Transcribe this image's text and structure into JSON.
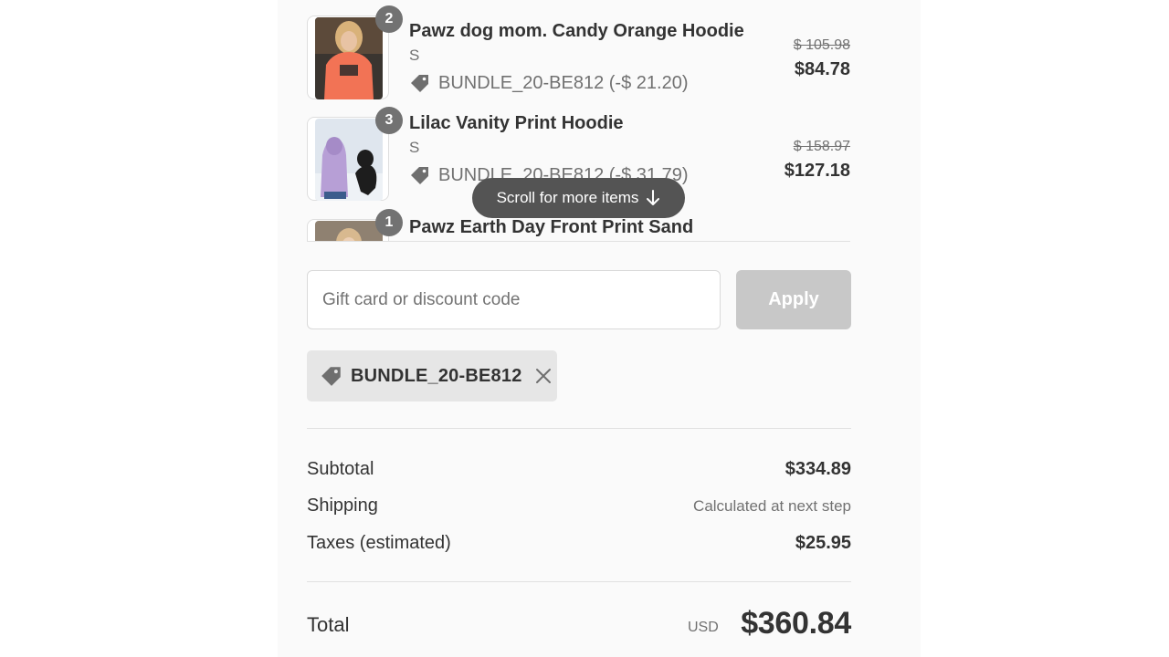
{
  "order_items": [
    {
      "quantity": "2",
      "name": "Pawz dog mom. Candy Orange Hoodie",
      "variant": "S",
      "discount": "BUNDLE_20-BE812 (-$ 21.20)",
      "original_price": "$ 105.98",
      "price": "$84.78"
    },
    {
      "quantity": "3",
      "name": "Lilac Vanity Print Hoodie",
      "variant": "S",
      "discount": "BUNDLE_20-BE812 (-$ 31.79)",
      "original_price": "$ 158.97",
      "price": "$127.18"
    },
    {
      "quantity": "1",
      "name": "Pawz Earth Day Front Print Sand"
    }
  ],
  "scroll_hint": {
    "label": "Scroll for more items",
    "icon": "arrow-down-icon"
  },
  "discount_form": {
    "placeholder": "Gift card or discount code",
    "value": "",
    "apply_label": "Apply"
  },
  "applied_code": {
    "label": "BUNDLE_20-BE812",
    "icon": "tag-icon",
    "remove_icon": "close-icon"
  },
  "summary": {
    "subtotal_label": "Subtotal",
    "subtotal_value": "$334.89",
    "shipping_label": "Shipping",
    "shipping_value": "Calculated at next step",
    "taxes_label": "Taxes (estimated)",
    "taxes_value": "$25.95"
  },
  "total": {
    "label": "Total",
    "currency": "USD",
    "amount": "$360.84"
  },
  "colors": {
    "panel_background": "#fafafa",
    "badge": "#727272",
    "scroll_pill": "#545454",
    "apply_button_disabled": "#c8c8c8",
    "chip_background": "#e6e6e6"
  }
}
